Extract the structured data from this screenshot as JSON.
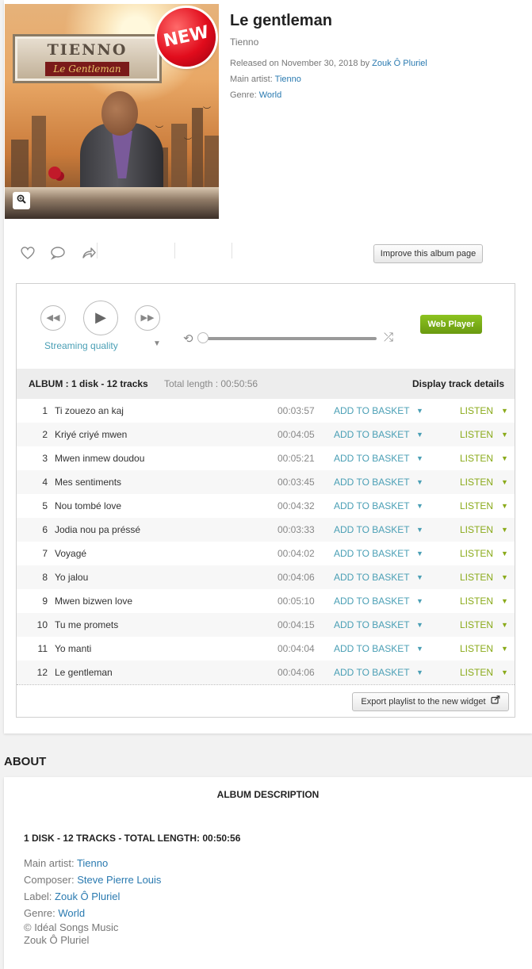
{
  "album": {
    "title": "Le gentleman",
    "artist": "Tienno",
    "released_prefix": "Released on November 30, 2018 by ",
    "label": "Zouk Ô Pluriel",
    "main_artist_prefix": "Main artist: ",
    "main_artist": "Tienno",
    "genre_prefix": "Genre: ",
    "genre": "World",
    "cover": {
      "new_badge": "NEW",
      "frame_title": "TIENNO",
      "frame_subtitle": "Le Gentleman",
      "zoom_icon": "zoom-in-icon"
    }
  },
  "actions": {
    "icons": [
      "heart-icon",
      "comment-icon",
      "share-icon"
    ],
    "improve_label": "Improve this album page"
  },
  "player": {
    "quality_label": "Streaming quality",
    "web_player_label": "Web Player",
    "controls": [
      "rewind-icon",
      "play-icon",
      "fast-forward-icon",
      "repeat-icon",
      "shuffle-icon"
    ]
  },
  "tracklist": {
    "album_summary": "ALBUM : 1 disk - 12 tracks",
    "total_length": "Total length : 00:50:56",
    "display_details": "Display track details",
    "basket_label": "ADD TO BASKET",
    "listen_label": "LISTEN",
    "tracks": [
      {
        "num": "1",
        "title": "Ti zouezo an kaj",
        "duration": "00:03:57"
      },
      {
        "num": "2",
        "title": "Kriyé criyé mwen",
        "duration": "00:04:05"
      },
      {
        "num": "3",
        "title": "Mwen inmew doudou",
        "duration": "00:05:21"
      },
      {
        "num": "4",
        "title": "Mes sentiments",
        "duration": "00:03:45"
      },
      {
        "num": "5",
        "title": "Nou tombé love",
        "duration": "00:04:32"
      },
      {
        "num": "6",
        "title": "Jodia nou pa préssé",
        "duration": "00:03:33"
      },
      {
        "num": "7",
        "title": "Voyagé",
        "duration": "00:04:02"
      },
      {
        "num": "8",
        "title": "Yo jalou",
        "duration": "00:04:06"
      },
      {
        "num": "9",
        "title": "Mwen bizwen love",
        "duration": "00:05:10"
      },
      {
        "num": "10",
        "title": "Tu me promets",
        "duration": "00:04:15"
      },
      {
        "num": "11",
        "title": "Yo manti",
        "duration": "00:04:04"
      },
      {
        "num": "12",
        "title": "Le gentleman",
        "duration": "00:04:06"
      }
    ],
    "export_label": "Export playlist to the new widget"
  },
  "about": {
    "section_title": "ABOUT",
    "description_title": "ALBUM DESCRIPTION",
    "summary": "1 DISK - 12 TRACKS - TOTAL LENGTH: 00:50:56",
    "main_artist_prefix": "Main artist: ",
    "main_artist": "Tienno",
    "composer_prefix": "Composer: ",
    "composer": "Steve Pierre Louis",
    "label_prefix": "Label: ",
    "label": "Zouk Ô Pluriel",
    "genre_prefix": "Genre: ",
    "genre": "World",
    "copyright": "© Idéal Songs Music",
    "copyright_label": "Zouk Ô Pluriel"
  },
  "colors": {
    "link": "#2a7ab0",
    "basket": "#4a9fb5",
    "listen": "#8aaa1a",
    "web_player": "#7cb118"
  }
}
